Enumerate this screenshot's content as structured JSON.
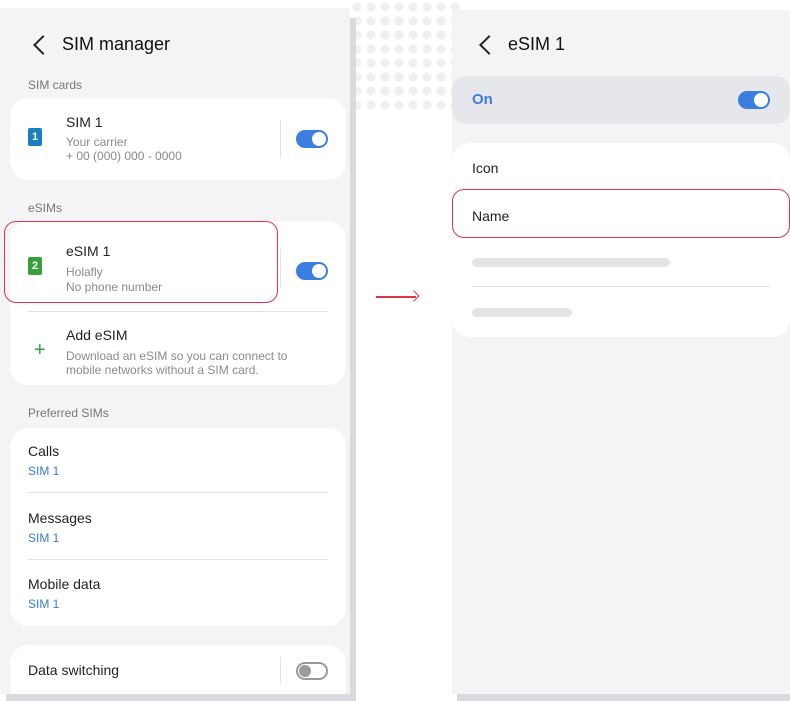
{
  "left_screen": {
    "title": "SIM manager",
    "sections": {
      "sim_cards": "SIM cards",
      "esims": "eSIMs",
      "preferred": "Preferred SIMs"
    },
    "sim1": {
      "badge": "1",
      "name": "SIM 1",
      "carrier": "Your carrier",
      "number": "+ 00 (000) 000 - 0000",
      "enabled": true
    },
    "esim1": {
      "badge": "2",
      "name": "eSIM 1",
      "carrier": "Holafly",
      "number": "No phone number",
      "enabled": true
    },
    "add_esim": {
      "title": "Add eSIM",
      "desc_line1": "Download an eSIM so you can connect to",
      "desc_line2": "mobile networks without a SIM card."
    },
    "preferred": [
      {
        "title": "Calls",
        "value": "SIM 1"
      },
      {
        "title": "Messages",
        "value": "SIM 1"
      },
      {
        "title": "Mobile data",
        "value": "SIM 1"
      }
    ],
    "data_switching": {
      "label": "Data switching",
      "enabled": false
    }
  },
  "right_screen": {
    "title": "eSIM 1",
    "on_label": "On",
    "enabled": true,
    "items": {
      "icon": "Icon",
      "name": "Name"
    }
  },
  "colors": {
    "accent": "#3b7de0",
    "highlight": "#e0334d",
    "sim_blue": "#1a7ec2",
    "sim_green": "#3aa13a"
  }
}
